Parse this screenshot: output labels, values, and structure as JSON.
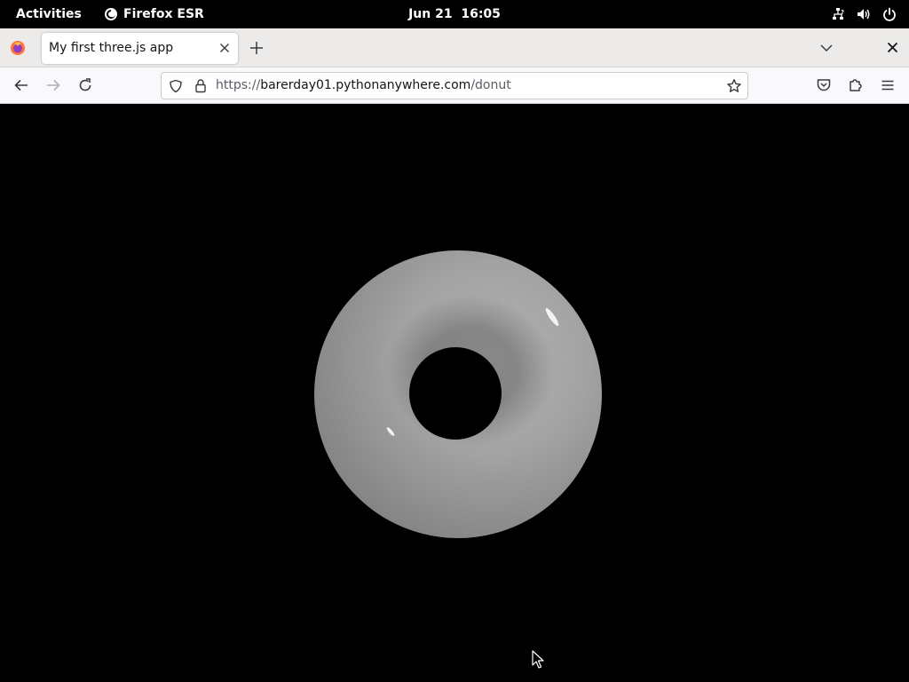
{
  "topbar": {
    "activities_label": "Activities",
    "app_name": "Firefox ESR",
    "clock": "Jun 21  16:05",
    "tray_icons": [
      "network-icon",
      "volume-icon",
      "power-icon"
    ]
  },
  "browser": {
    "tab_title": "My first three.js app",
    "url": {
      "scheme": "https://",
      "host": "barerday01.pythonanywhere.com",
      "path": "/donut"
    }
  },
  "scene": {
    "object": "torus",
    "background": "#000000",
    "color": "#9a9a9a"
  }
}
